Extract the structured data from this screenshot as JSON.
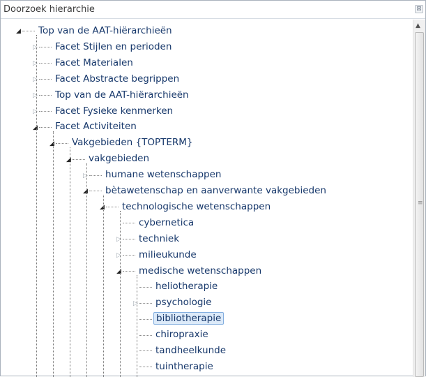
{
  "panel": {
    "title": "Doorzoek hierarchie",
    "close_symbol": "⊠"
  },
  "tree": [
    {
      "label": "Top van de AAT-hiërarchieën",
      "depth": 0,
      "state": "expanded",
      "selected": false
    },
    {
      "label": "Facet Stijlen en perioden",
      "depth": 1,
      "state": "collapsed",
      "selected": false
    },
    {
      "label": "Facet Materialen",
      "depth": 1,
      "state": "collapsed",
      "selected": false
    },
    {
      "label": "Facet Abstracte begrippen",
      "depth": 1,
      "state": "collapsed",
      "selected": false
    },
    {
      "label": "Top van de AAT-hiërarchieën",
      "depth": 1,
      "state": "collapsed",
      "selected": false
    },
    {
      "label": "Facet Fysieke kenmerken",
      "depth": 1,
      "state": "collapsed",
      "selected": false
    },
    {
      "label": "Facet Activiteiten",
      "depth": 1,
      "state": "expanded",
      "selected": false
    },
    {
      "label": "Vakgebieden {TOPTERM}",
      "depth": 2,
      "state": "expanded",
      "selected": false
    },
    {
      "label": "vakgebieden",
      "depth": 3,
      "state": "expanded",
      "selected": false
    },
    {
      "label": "humane wetenschappen",
      "depth": 4,
      "state": "collapsed",
      "selected": false
    },
    {
      "label": "bètawetenschap en aanverwante vakgebieden",
      "depth": 4,
      "state": "expanded",
      "selected": false
    },
    {
      "label": "technologische wetenschappen",
      "depth": 5,
      "state": "expanded",
      "selected": false
    },
    {
      "label": "cybernetica",
      "depth": 6,
      "state": "leaf",
      "selected": false
    },
    {
      "label": "techniek",
      "depth": 6,
      "state": "collapsed",
      "selected": false
    },
    {
      "label": "milieukunde",
      "depth": 6,
      "state": "collapsed",
      "selected": false
    },
    {
      "label": "medische wetenschappen",
      "depth": 6,
      "state": "expanded",
      "selected": false
    },
    {
      "label": "heliotherapie",
      "depth": 7,
      "state": "leaf",
      "selected": false
    },
    {
      "label": "psychologie",
      "depth": 7,
      "state": "collapsed",
      "selected": false
    },
    {
      "label": "bibliotherapie",
      "depth": 7,
      "state": "leaf",
      "selected": true
    },
    {
      "label": "chiropraxie",
      "depth": 7,
      "state": "leaf",
      "selected": false
    },
    {
      "label": "tandheelkunde",
      "depth": 7,
      "state": "leaf",
      "selected": false
    },
    {
      "label": "tuintherapie",
      "depth": 7,
      "state": "leaf",
      "selected": false
    }
  ],
  "icons": {
    "expanded": "◢",
    "collapsed": "▷",
    "scroll_up": "▲",
    "grip": "≡"
  }
}
